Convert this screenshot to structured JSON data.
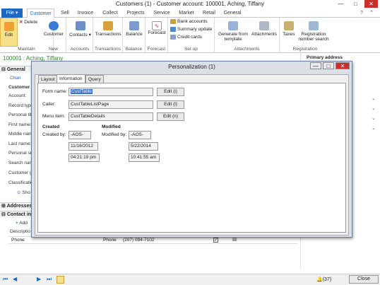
{
  "window": {
    "title": "Customers (1) - Customer account: 100001, Aching, Tiffany"
  },
  "menu": {
    "file": "File",
    "tabs": [
      "Customer",
      "Sell",
      "Invoice",
      "Collect",
      "Projects",
      "Service",
      "Market",
      "Retail",
      "General"
    ]
  },
  "ribbon": {
    "edit": "Edit",
    "delete": "Delete",
    "maintain": "Maintain",
    "customer": "Customer",
    "new": "New",
    "contacts": "Contacts",
    "accounts": "Accounts",
    "transactions": "Transactions",
    "transactions_group": "Transactions",
    "balance": "Balance",
    "balance_group": "Balance",
    "forecast": "Forecast",
    "forecast_group": "Forecast",
    "bank_accounts": "Bank accounts",
    "summary_update": "Summary update",
    "credit_cards": "Credit cards",
    "setup": "Set up",
    "generate_from_template": "Generate from template",
    "attachments": "Attachments",
    "attachments_group": "Attachments",
    "taxes": "Taxes",
    "registration_number_search": "Registration number search",
    "registration": "Registration"
  },
  "left": {
    "customer_header": "100001 : Aching, Tiffany",
    "general": "General",
    "change": "Chan",
    "customer_label": "Customer",
    "fields": [
      "Account:",
      "Record type",
      "Personal tit",
      "First name:",
      "Middle nam",
      "Last name:",
      "Personal su",
      "Search nam",
      "Customer g",
      "Classificatio"
    ],
    "show": "Sho",
    "addresses": "Addresses",
    "contact_info": "Contact in",
    "add": "Add",
    "description_col": "Descriptio",
    "phone_row": {
      "description": "Phone",
      "type": "Phone",
      "value": "(207) 094-7102"
    }
  },
  "right": {
    "primary_address": "Primary address"
  },
  "dialog": {
    "title": "Personalization (1)",
    "tabs": [
      "Layout",
      "Information",
      "Query"
    ],
    "form_name_label": "Form name:",
    "form_name_value": "CustTable",
    "caller_label": "Caller:",
    "caller_value": "CustTableListPage",
    "menu_item_label": "Menu item:",
    "menu_item_value": "CustTableDetails",
    "edit_i": "Edit (i)",
    "edit_l": "Edit (l)",
    "edit_n": "Edit (n)",
    "created": "Created",
    "modified": "Modified",
    "created_by_label": "Created by:",
    "created_by": "-AOS-",
    "created_date": "11/16/2012",
    "created_time": "04:21:19 pm",
    "modified_by_label": "Modified by:",
    "modified_by": "-AOS-",
    "modified_date": "5/22/2014",
    "modified_time": "10:41:55 am"
  },
  "status": {
    "alerts": "(37)",
    "close": "Close"
  },
  "colors": {
    "accent": "#1e66c1",
    "customer_header": "#2a8a2a"
  }
}
